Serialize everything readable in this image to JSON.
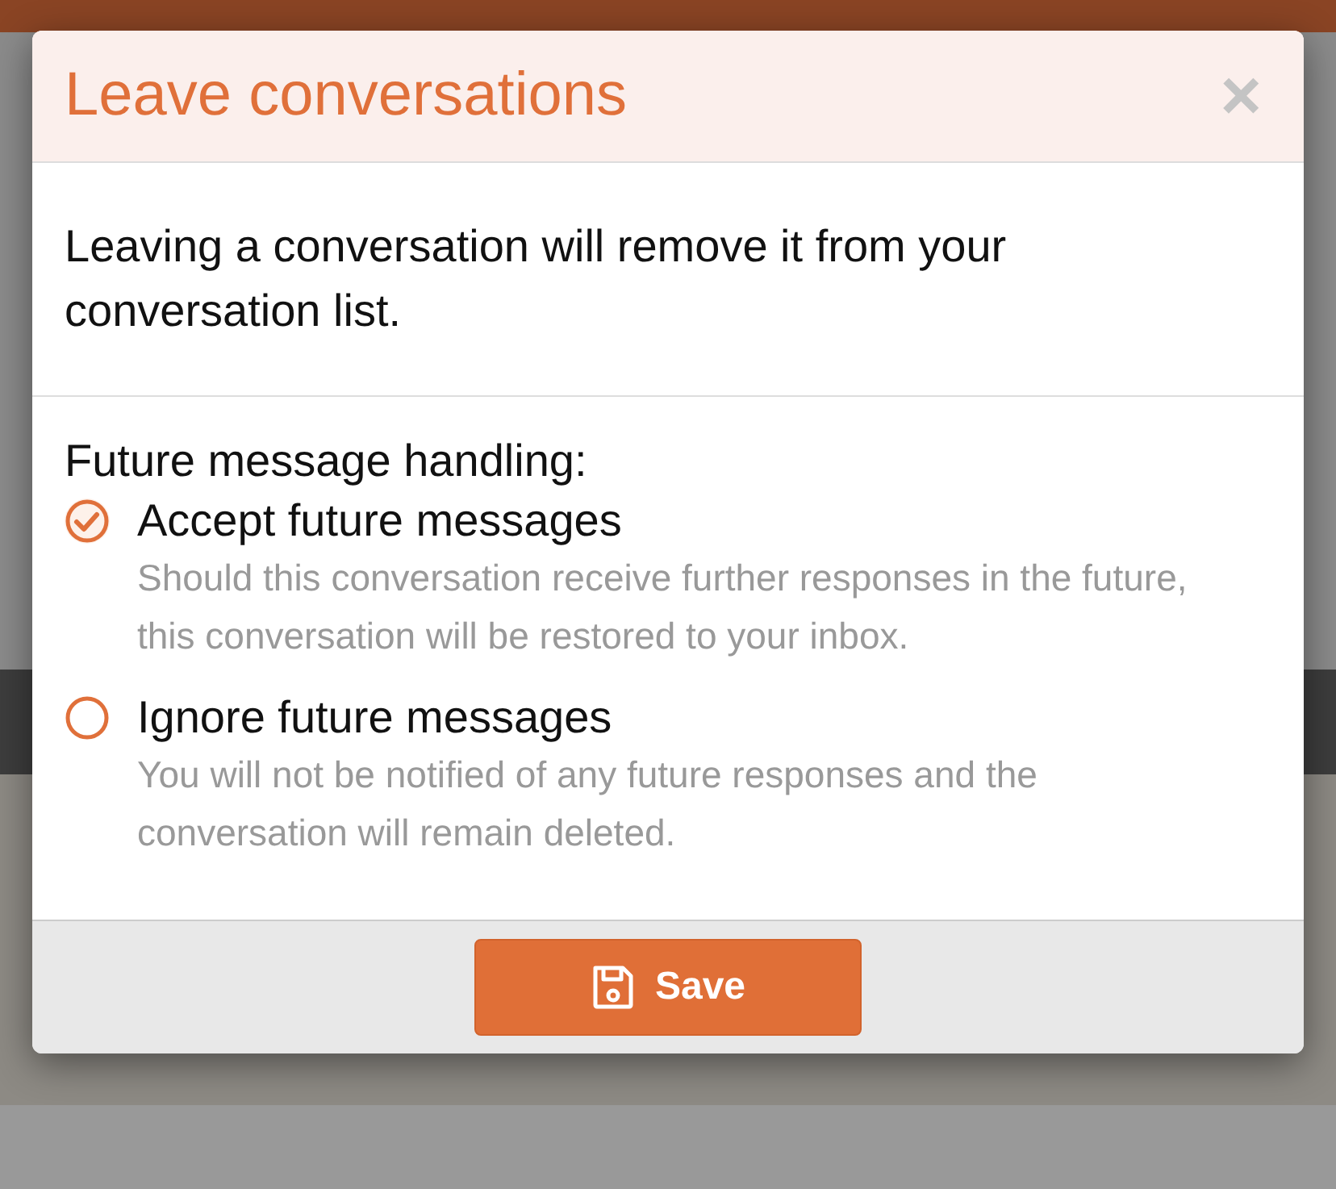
{
  "dialog": {
    "title": "Leave conversations",
    "close": "×",
    "intro": "Leaving a conversation will remove it from your conversation list.",
    "section_label": "Future message handling:",
    "options": [
      {
        "label": "Accept future messages",
        "description": "Should this conversation receive further responses in the future, this conversation will be restored to your inbox.",
        "selected": true
      },
      {
        "label": "Ignore future messages",
        "description": "You will not be notified of any future responses and the conversation will remain deleted.",
        "selected": false
      }
    ],
    "save_button": "Save"
  }
}
